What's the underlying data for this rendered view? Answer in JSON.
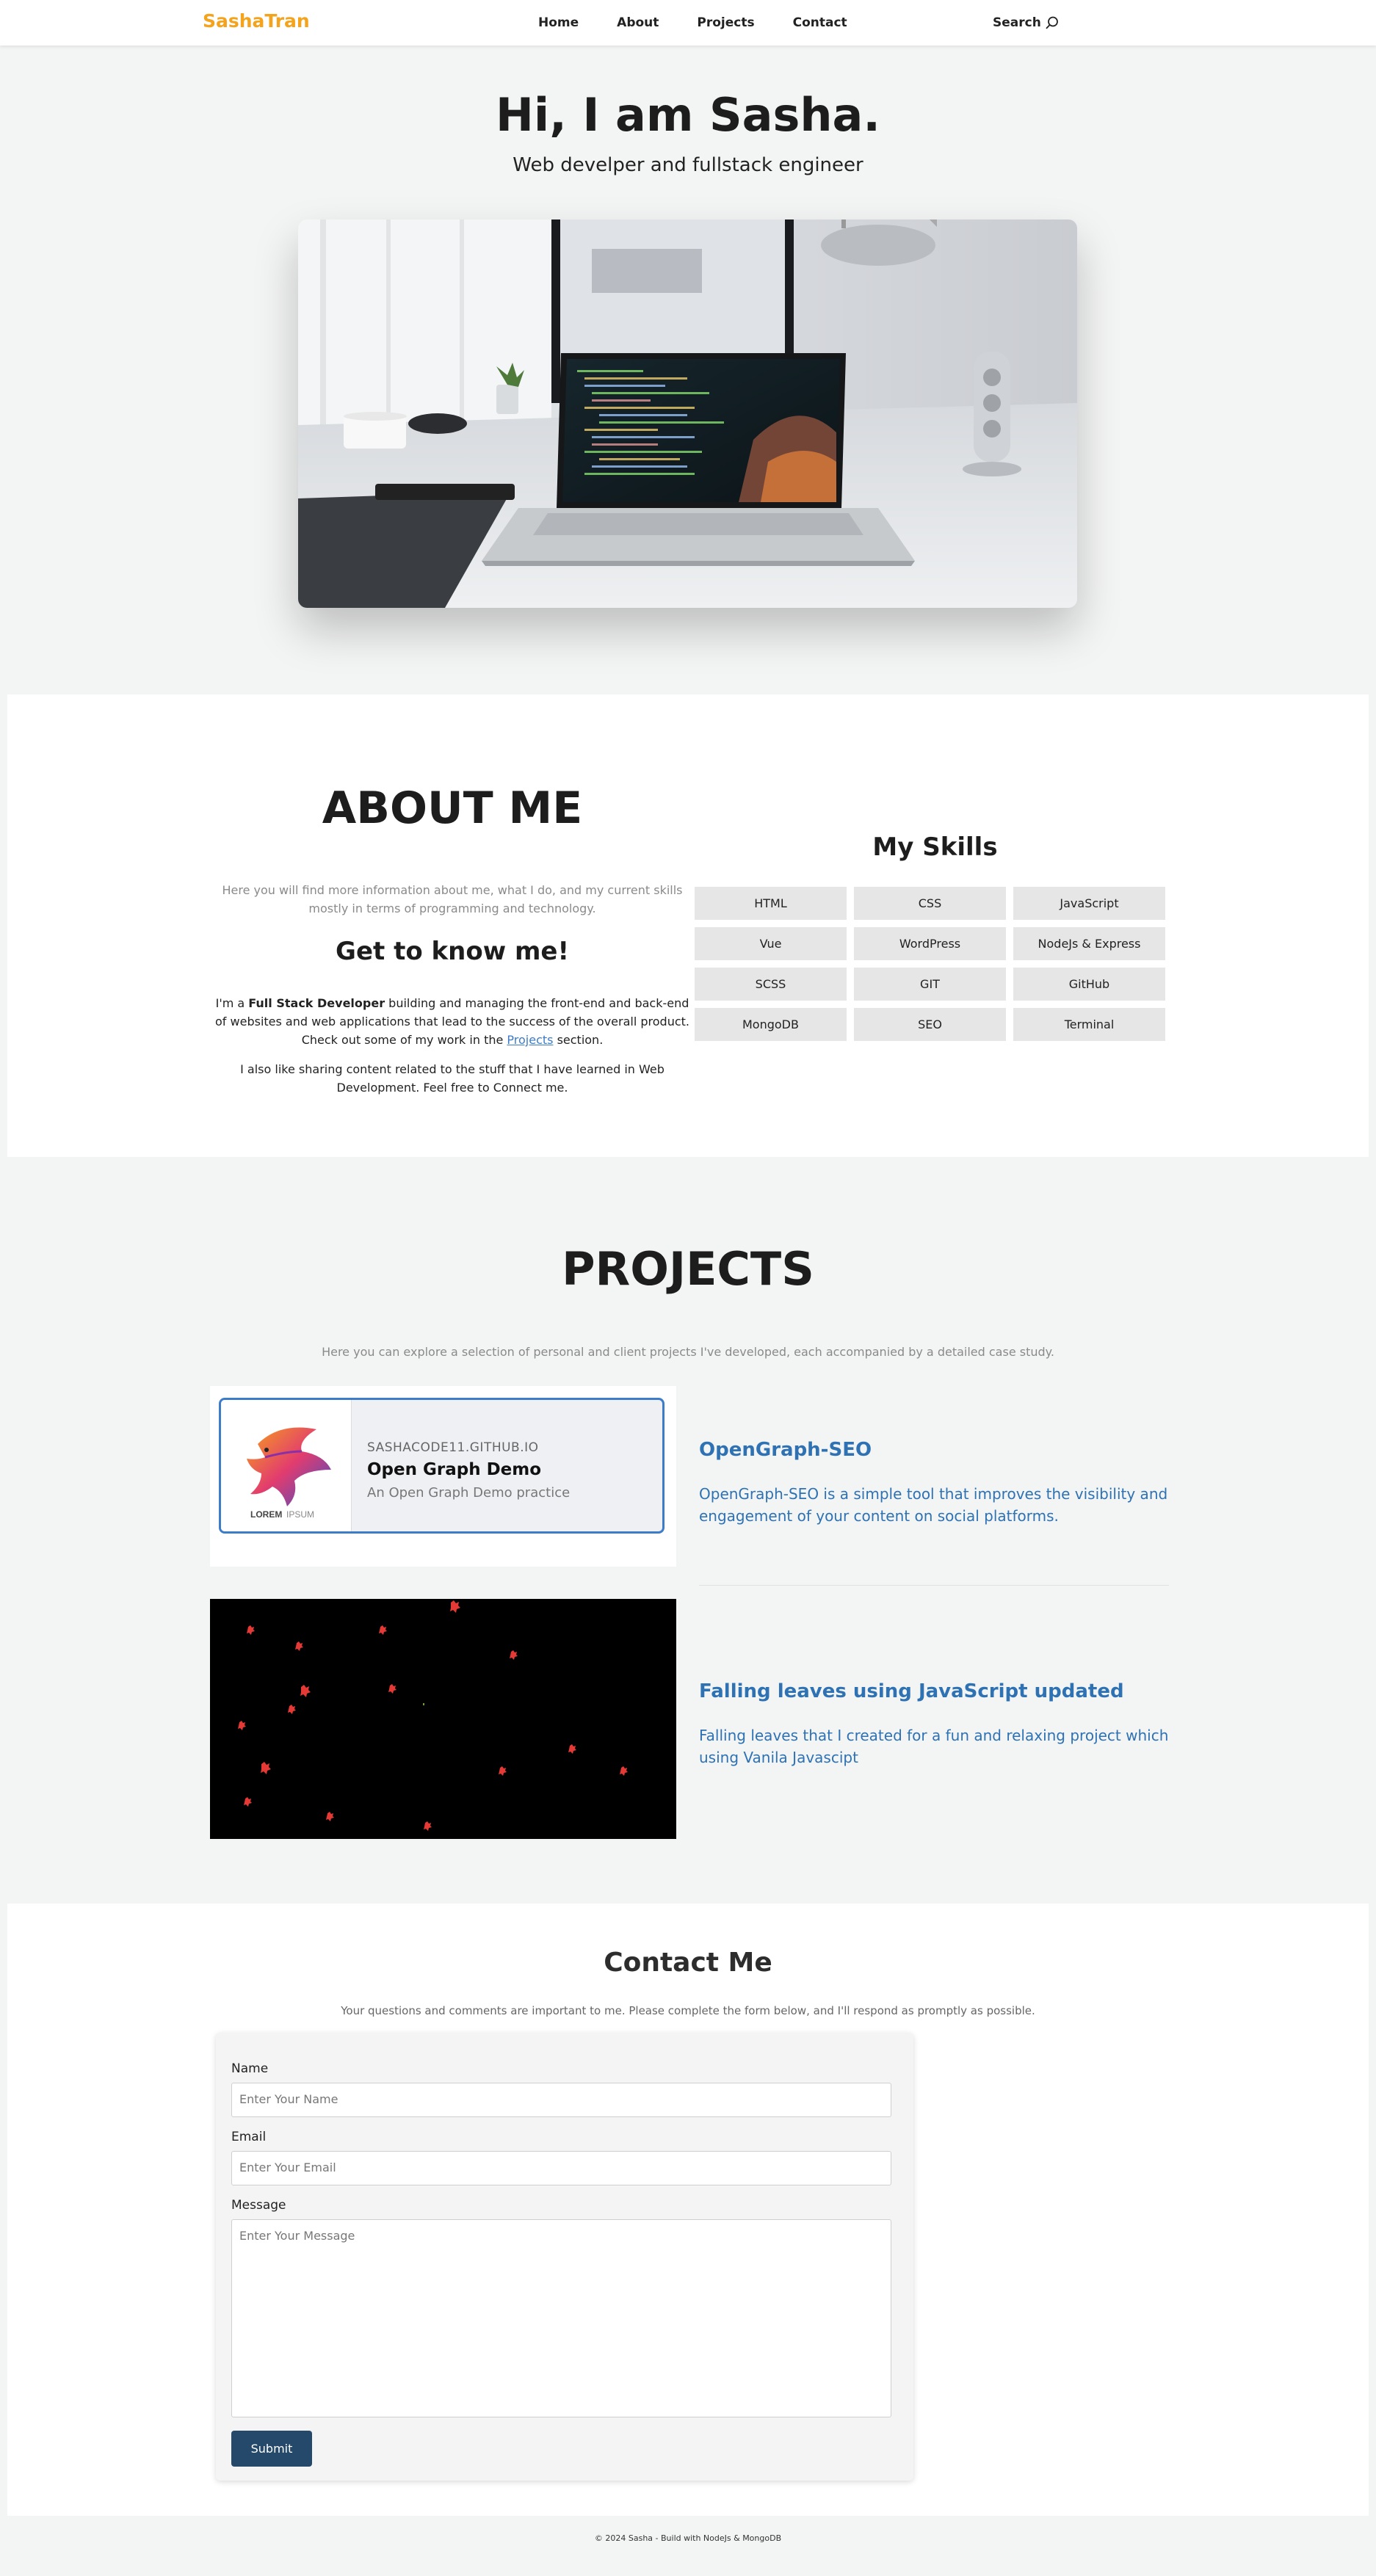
{
  "nav": {
    "logo": "SashaTran",
    "links": [
      "Home",
      "About",
      "Projects",
      "Contact"
    ],
    "search_label": "Search"
  },
  "hero": {
    "title": "Hi, I am Sasha.",
    "subtitle": "Web develper and fullstack engineer"
  },
  "about": {
    "title": "ABOUT ME",
    "description": "Here you will find more information about me, what I do, and my current skills mostly in terms of programming and technology.",
    "subtitle": "Get to know me!",
    "p1_prefix": "I'm a ",
    "p1_bold": "Full Stack Developer",
    "p1_middle": " building and managing the front-end and back-end of websites and web applications that lead to the success of the overall product. Check out some of my work in the ",
    "p1_link": "Projects",
    "p1_suffix": " section.",
    "p2": "I also like sharing content related to the stuff that I have learned in Web Development. Feel free to Connect me."
  },
  "skills": {
    "title": "My Skills",
    "items": [
      "HTML",
      "CSS",
      "JavaScript",
      "Vue",
      "WordPress",
      "NodeJs & Express",
      "SCSS",
      "GIT",
      "GitHub",
      "MongoDB",
      "SEO",
      "Terminal"
    ]
  },
  "projects": {
    "title": "PROJECTS",
    "description": "Here you can explore a selection of personal and client projects I've developed, each accompanied by a detailed case study.",
    "items": [
      {
        "title": "OpenGraph-SEO",
        "description": "OpenGraph-SEO is a simple tool that improves the visibility and engagement of your content on social platforms.",
        "preview": {
          "url": "SASHACODE11.GITHUB.IO",
          "name": "Open Graph Demo",
          "description": "An Open Graph Demo practice",
          "logo_text_1": "LOREM",
          "logo_text_2": "IPSUM"
        }
      },
      {
        "title": "Falling leaves using JavaScript updated",
        "description": "Falling leaves that I created for a fun and relaxing project which using Vanila Javascipt"
      }
    ]
  },
  "contact": {
    "title": "Contact Me",
    "description": "Your questions and comments are important to me. Please complete the form below, and I'll respond as promptly as possible.",
    "name_label": "Name",
    "name_placeholder": "Enter Your Name",
    "email_label": "Email",
    "email_placeholder": "Enter Your Email",
    "message_label": "Message",
    "message_placeholder": "Enter Your Message",
    "submit_label": "Submit"
  },
  "footer": {
    "text": "© 2024 Sasha - Build with NodeJs & MongoDB"
  },
  "colors": {
    "accent": "#f4a31c",
    "link": "#2e72b3",
    "submit": "#24496a",
    "background": "#f3f4f4"
  },
  "icons": [
    "search-icon"
  ]
}
